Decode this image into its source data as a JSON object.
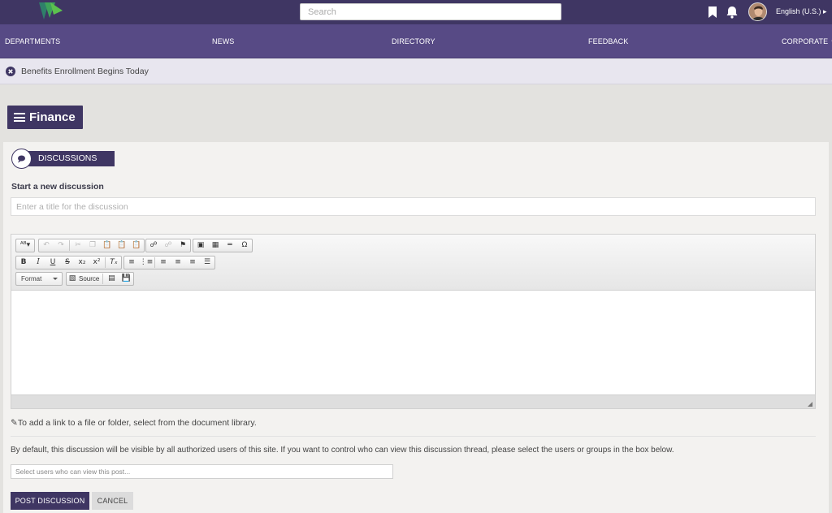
{
  "colors": {
    "brand_dark": "#3f3663",
    "nav": "#574a85",
    "logo_green": "#48b54a",
    "logo_teal": "#2f8f7a"
  },
  "header": {
    "logo_icon": "company-logo",
    "search_placeholder": "Search",
    "icons": [
      "bookmark-icon",
      "bell-icon",
      "avatar"
    ],
    "language": "English (U.S.)"
  },
  "nav": {
    "items": [
      {
        "label": "DEPARTMENTS"
      },
      {
        "label": "NEWS"
      },
      {
        "label": "DIRECTORY"
      },
      {
        "label": "FEEDBACK"
      },
      {
        "label": "CORPORATE"
      }
    ]
  },
  "alert": {
    "text": "Benefits Enrollment Begins Today",
    "icon": "close-circle-icon"
  },
  "page": {
    "title": "Finance",
    "menu_icon": "hamburger-icon"
  },
  "discussions": {
    "section_label": "DISCUSSIONS",
    "section_icon": "chat-bubble-icon",
    "start_label": "Start a new discussion",
    "title_placeholder": "Enter a title for the discussion",
    "editor": {
      "format_label": "Format",
      "source_label": "Source"
    },
    "link_note": "To add a link to a file or folder, select from the document library.",
    "link_icon": "paperclip-icon",
    "visibility_note": "By default, this discussion will be visible by all authorized users of this site. If you want to control who can view this discussion thread, please select the users or groups in the box below.",
    "users_placeholder": "Select users who can view this post...",
    "post_button": "POST DISCUSSION",
    "cancel_button": "CANCEL"
  }
}
